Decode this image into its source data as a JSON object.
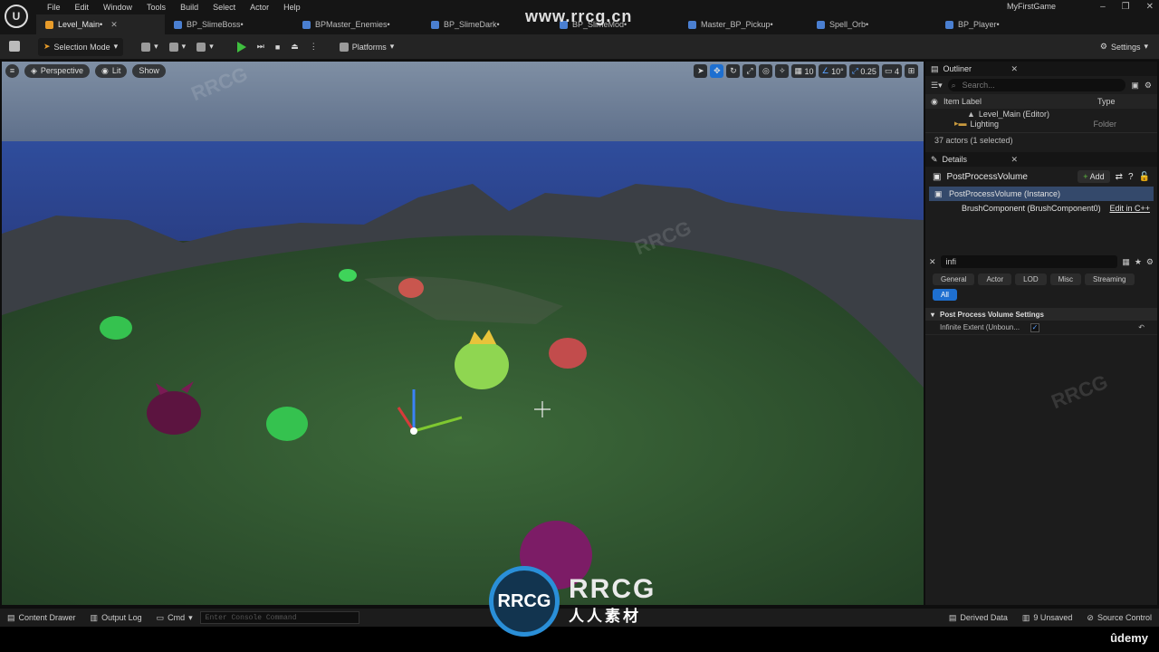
{
  "menu": {
    "items": [
      "File",
      "Edit",
      "Window",
      "Tools",
      "Build",
      "Select",
      "Actor",
      "Help"
    ],
    "project": "MyFirstGame"
  },
  "tabs": [
    {
      "label": "Level_Main•",
      "active": true
    },
    {
      "label": "BP_SlimeBoss•"
    },
    {
      "label": "BPMaster_Enemies•"
    },
    {
      "label": "BP_SlimeDark•"
    },
    {
      "label": "BP_SlimeMod•"
    },
    {
      "label": "Master_BP_Pickup•"
    },
    {
      "label": "Spell_Orb•"
    },
    {
      "label": "BP_Player•"
    }
  ],
  "toolbar": {
    "mode": "Selection Mode",
    "platforms": "Platforms",
    "settings": "Settings"
  },
  "viewport": {
    "perspective": "Perspective",
    "lit": "Lit",
    "show": "Show",
    "grid": "10",
    "angle": "10°",
    "scale": "0.25",
    "speed": "4"
  },
  "outliner": {
    "title": "Outliner",
    "search_placeholder": "Search...",
    "col_label": "Item Label",
    "col_type": "Type",
    "rows": [
      {
        "label": "Level_Main (Editor)",
        "type": ""
      },
      {
        "label": "Lighting",
        "type": "Folder"
      }
    ],
    "actors": "37 actors (1 selected)"
  },
  "details": {
    "title": "Details",
    "object": "PostProcessVolume",
    "add": "Add",
    "instance": "PostProcessVolume (Instance)",
    "component": "BrushComponent (BrushComponent0)",
    "edit_cpp": "Edit in C++",
    "filter": "infi",
    "categories": [
      "General",
      "Actor",
      "LOD",
      "Misc",
      "Streaming",
      "All"
    ],
    "section": "Post Process Volume Settings",
    "property": "Infinite Extent (Unboun..."
  },
  "status": {
    "content_drawer": "Content Drawer",
    "output_log": "Output Log",
    "cmd": "Cmd",
    "console_placeholder": "Enter Console Command",
    "derived": "Derived Data",
    "unsaved": "9 Unsaved",
    "source": "Source Control"
  },
  "watermark": {
    "site": "www.rrcg.cn",
    "brand": "RRCG",
    "brand_sub": "人人素材",
    "udemy": "ûdemy"
  }
}
